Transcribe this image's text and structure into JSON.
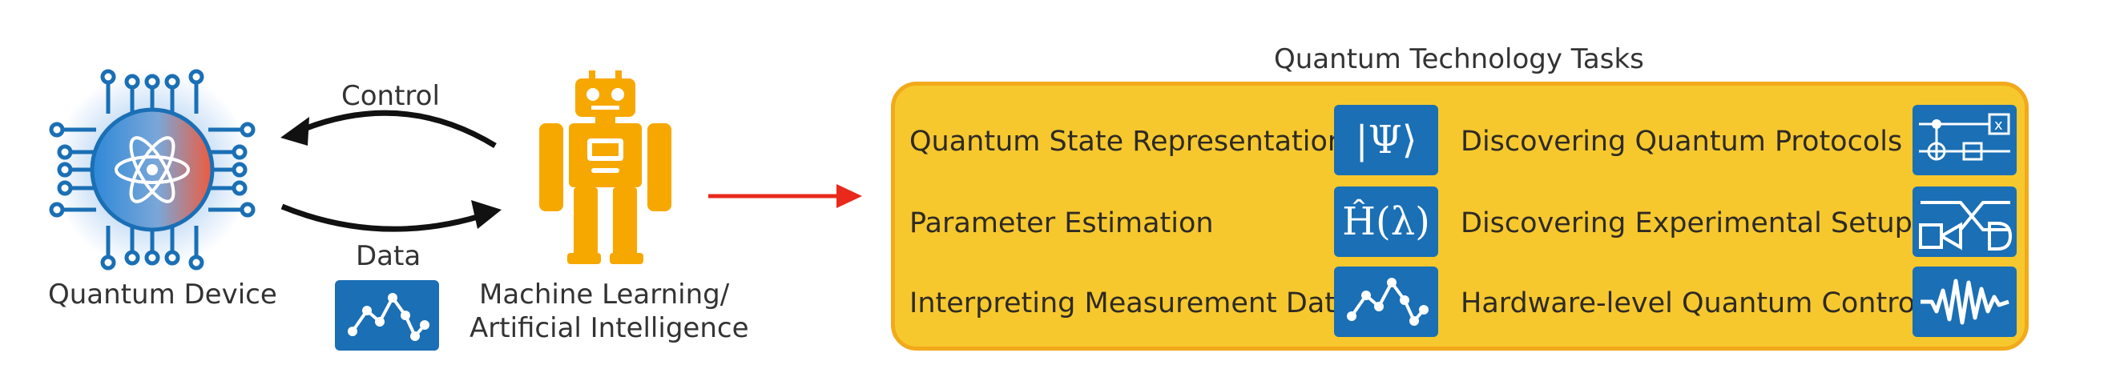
{
  "left": {
    "device_label": "Quantum Device",
    "control_label": "Control",
    "data_label": "Data",
    "ml_label_line1": "Machine Learning/",
    "ml_label_line2": "Artificial Intelligence"
  },
  "tasks_panel": {
    "title": "Quantum Technology Tasks",
    "items": [
      {
        "label": "Quantum State Representation",
        "icon": "psi-ket-icon",
        "math": "|Ψ⟩"
      },
      {
        "label": "Parameter Estimation",
        "icon": "hamiltonian-icon",
        "math": "Ĥ(λ)"
      },
      {
        "label": "Interpreting Measurement Data",
        "icon": "data-plot-icon"
      },
      {
        "label": "Discovering Quantum Protocols",
        "icon": "circuit-icon"
      },
      {
        "label": "Discovering Experimental Setups",
        "icon": "optical-setup-icon"
      },
      {
        "label": "Hardware-level Quantum Control",
        "icon": "waveform-icon"
      }
    ]
  },
  "colors": {
    "panel_fill": "#f6c82e",
    "panel_border": "#f2a91a",
    "icon_blue": "#1a6fb5",
    "robot": "#f7a800",
    "arrow_red": "#e8291c",
    "chip_blue": "#2e88d8",
    "chip_red": "#f05a3c"
  }
}
